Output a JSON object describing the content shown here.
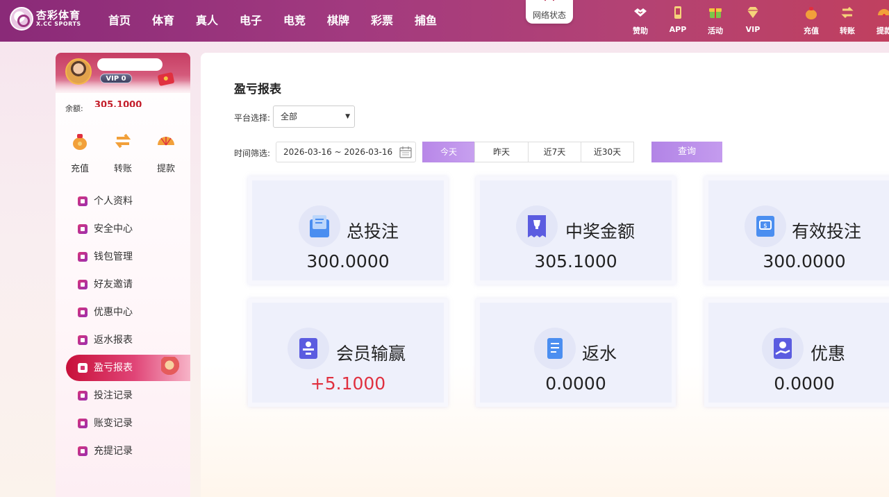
{
  "header": {
    "logo_title": "杏彩体育",
    "logo_sub": "X.CC SPORTS",
    "nav": [
      "首页",
      "体育",
      "真人",
      "电子",
      "电竞",
      "棋牌",
      "彩票",
      "捕鱼"
    ],
    "network_status": "网络状态",
    "icons": [
      {
        "label": "赞助",
        "icon": "handshake-icon"
      },
      {
        "label": "APP",
        "icon": "phone-icon"
      },
      {
        "label": "活动",
        "icon": "gift-box-icon"
      },
      {
        "label": "VIP",
        "icon": "diamond-icon"
      },
      {
        "label": "充值",
        "icon": "money-bag-icon"
      },
      {
        "label": "转账",
        "icon": "transfer-icon"
      },
      {
        "label": "提款",
        "icon": "withdraw-fan-icon"
      }
    ]
  },
  "sidebar": {
    "vip": "VIP 0",
    "balance_label": "余额:",
    "balance_value": "305.1000",
    "quick": [
      {
        "label": "充值",
        "icon": "money-bag-icon"
      },
      {
        "label": "转账",
        "icon": "transfer-icon"
      },
      {
        "label": "提款",
        "icon": "withdraw-fan-icon"
      }
    ],
    "menu": [
      {
        "label": "个人资料",
        "icon": "profile-icon",
        "active": false
      },
      {
        "label": "安全中心",
        "icon": "shield-icon",
        "active": false
      },
      {
        "label": "钱包管理",
        "icon": "wallet-icon",
        "active": false
      },
      {
        "label": "好友邀请",
        "icon": "invite-icon",
        "active": false
      },
      {
        "label": "优惠中心",
        "icon": "promotion-icon",
        "active": false
      },
      {
        "label": "返水报表",
        "icon": "rebate-report-icon",
        "active": false
      },
      {
        "label": "盈亏报表",
        "icon": "profit-loss-icon",
        "active": true
      },
      {
        "label": "投注记录",
        "icon": "bet-record-icon",
        "active": false
      },
      {
        "label": "账变记录",
        "icon": "account-change-icon",
        "active": false
      },
      {
        "label": "充提记录",
        "icon": "deposit-withdraw-icon",
        "active": false
      }
    ]
  },
  "main": {
    "title": "盈亏报表",
    "platform_label": "平台选择:",
    "platform_value": "全部",
    "time_label": "时间筛选:",
    "date_range": "2026-03-16 ~ 2026-03-16",
    "quick_dates": [
      "今天",
      "昨天",
      "近7天",
      "近30天"
    ],
    "active_quick_date": "今天",
    "query_label": "查询",
    "cards": [
      {
        "name": "总投注",
        "value": "300.0000",
        "icon": "total-bet-icon"
      },
      {
        "name": "中奖金额",
        "value": "305.1000",
        "icon": "prize-icon"
      },
      {
        "name": "有效投注",
        "value": "300.0000",
        "icon": "valid-bet-icon"
      },
      {
        "name": "会员输赢",
        "value": "+5.1000",
        "icon": "member-winloss-icon"
      },
      {
        "name": "返水",
        "value": "0.0000",
        "icon": "rebate-icon"
      },
      {
        "name": "优惠",
        "value": "0.0000",
        "icon": "discount-icon"
      }
    ]
  },
  "colors": {
    "header_start": "#8a2a78",
    "header_end": "#c0405f",
    "accent_purple": "#b887e8",
    "active_menu": "#c8103a",
    "positive_value": "#e0303f"
  }
}
